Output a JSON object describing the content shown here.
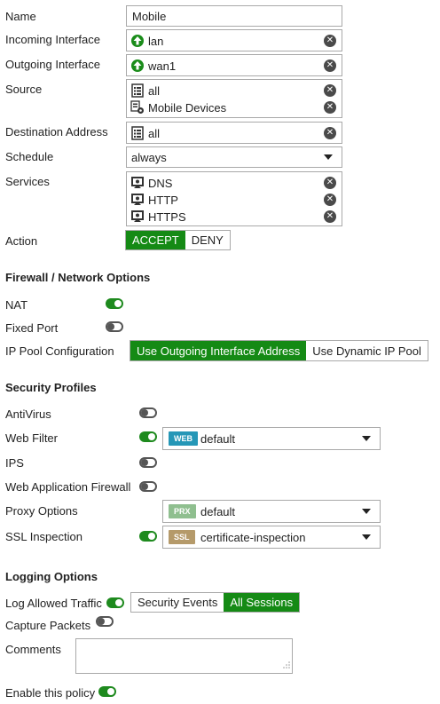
{
  "policy": {
    "name_label": "Name",
    "name_value": "Mobile",
    "incoming_label": "Incoming Interface",
    "incoming_value": "lan",
    "outgoing_label": "Outgoing Interface",
    "outgoing_value": "wan1",
    "source_label": "Source",
    "source_items": [
      "all",
      "Mobile Devices"
    ],
    "destination_label": "Destination Address",
    "destination_value": "all",
    "schedule_label": "Schedule",
    "schedule_value": "always",
    "services_label": "Services",
    "services_items": [
      "DNS",
      "HTTP",
      "HTTPS"
    ],
    "action_label": "Action",
    "action_options": [
      "ACCEPT",
      "DENY"
    ],
    "action_selected": "ACCEPT"
  },
  "firewall": {
    "title": "Firewall / Network Options",
    "nat_label": "NAT",
    "nat_on": true,
    "fixed_port_label": "Fixed Port",
    "fixed_port_on": false,
    "ip_pool_label": "IP Pool Configuration",
    "ip_pool_options": [
      "Use Outgoing Interface Address",
      "Use Dynamic IP Pool"
    ],
    "ip_pool_selected": "Use Outgoing Interface Address"
  },
  "security": {
    "title": "Security Profiles",
    "antivirus_label": "AntiVirus",
    "antivirus_on": false,
    "webfilter_label": "Web Filter",
    "webfilter_on": true,
    "webfilter_badge": "WEB",
    "webfilter_value": "default",
    "ips_label": "IPS",
    "ips_on": false,
    "waf_label": "Web Application Firewall",
    "waf_on": false,
    "proxy_label": "Proxy Options",
    "proxy_badge": "PRX",
    "proxy_value": "default",
    "ssl_label": "SSL Inspection",
    "ssl_on": true,
    "ssl_badge": "SSL",
    "ssl_value": "certificate-inspection"
  },
  "logging": {
    "title": "Logging Options",
    "log_traffic_label": "Log Allowed Traffic",
    "log_traffic_on": true,
    "log_options": [
      "Security Events",
      "All Sessions"
    ],
    "log_selected": "All Sessions",
    "capture_label": "Capture Packets",
    "capture_on": false,
    "comments_label": "Comments",
    "comments_value": "",
    "enable_label": "Enable this policy",
    "enable_on": true
  },
  "colors": {
    "accent_green": "#158a15",
    "web_badge": "#2597b7",
    "prx_badge": "#8fbf8f",
    "ssl_badge": "#b59a6a"
  },
  "icons": {
    "interface": "green-up-arrow-icon",
    "address": "address-list-icon",
    "address_group": "address-group-icon",
    "service": "service-icon",
    "remove": "remove-x-icon"
  }
}
